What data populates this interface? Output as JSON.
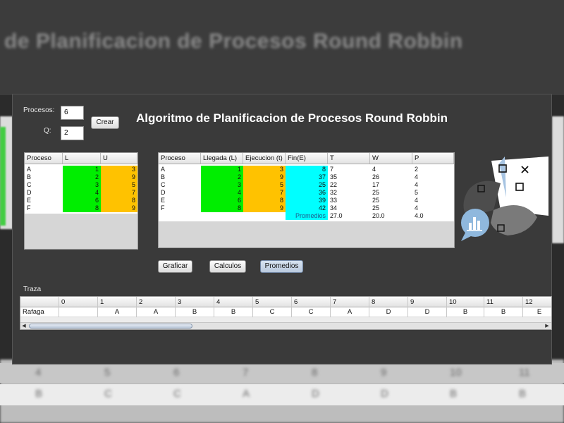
{
  "backdrop": {
    "title": "de Planificacion de Procesos Round Robbin",
    "row_numbers": [
      "4",
      "5",
      "6",
      "7",
      "8",
      "9",
      "10",
      "11"
    ],
    "row_letters": [
      "B",
      "C",
      "C",
      "A",
      "D",
      "D",
      "B",
      "B"
    ]
  },
  "form": {
    "procesos_label": "Procesos:",
    "procesos_value": "6",
    "q_label": "Q:",
    "q_value": "2",
    "crear_label": "Crear"
  },
  "title": "Algoritmo de Planificacion de Procesos Round Robbin",
  "input_table": {
    "headers": [
      "Proceso",
      "L",
      "U"
    ],
    "rows": [
      [
        "A",
        "1",
        "3"
      ],
      [
        "B",
        "2",
        "9"
      ],
      [
        "C",
        "3",
        "5"
      ],
      [
        "D",
        "4",
        "7"
      ],
      [
        "E",
        "6",
        "8"
      ],
      [
        "F",
        "8",
        "9"
      ]
    ]
  },
  "result_table": {
    "headers": [
      "Proceso",
      "Llegada (L)",
      "Ejecucion (t)",
      "Fin(E)",
      "T",
      "W",
      "P"
    ],
    "rows": [
      [
        "A",
        "1",
        "3",
        "8",
        "7",
        "4",
        "2"
      ],
      [
        "B",
        "2",
        "9",
        "37",
        "35",
        "26",
        "4"
      ],
      [
        "C",
        "3",
        "5",
        "25",
        "22",
        "17",
        "4"
      ],
      [
        "D",
        "4",
        "7",
        "36",
        "32",
        "25",
        "5"
      ],
      [
        "E",
        "6",
        "8",
        "39",
        "33",
        "25",
        "4"
      ],
      [
        "F",
        "8",
        "9",
        "42",
        "34",
        "25",
        "4"
      ]
    ],
    "promedios_label": "Promedios",
    "promedios": [
      "27.0",
      "20.0",
      "4.0"
    ]
  },
  "buttons": {
    "graficar": "Graficar",
    "calculos": "Calculos",
    "promedios": "Promedios"
  },
  "trace": {
    "label": "Traza",
    "header": [
      "",
      "0",
      "1",
      "2",
      "3",
      "4",
      "5",
      "6",
      "7",
      "8",
      "9",
      "10",
      "11",
      "12"
    ],
    "row": [
      "Rafaga",
      "",
      "A",
      "A",
      "B",
      "B",
      "C",
      "C",
      "A",
      "D",
      "D",
      "B",
      "B",
      "E"
    ]
  },
  "colors": {
    "arrival": "#00ee00",
    "burst": "#ffc200",
    "finish": "#00ffff",
    "panel": "#3a3a3a"
  },
  "icons": [
    "chart-bubble-icon",
    "checkbox-icon",
    "close-icon"
  ]
}
